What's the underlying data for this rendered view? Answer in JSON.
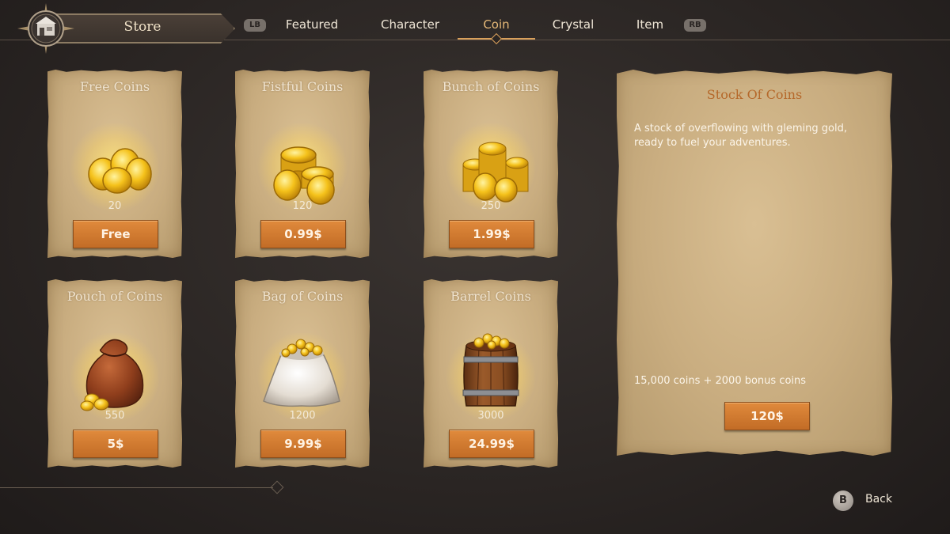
{
  "header": {
    "title": "Store",
    "lb_hint": "LB",
    "rb_hint": "RB",
    "tabs": [
      {
        "label": "Featured"
      },
      {
        "label": "Character"
      },
      {
        "label": "Coin"
      },
      {
        "label": "Crystal"
      },
      {
        "label": "Item"
      }
    ],
    "active_tab": "Coin"
  },
  "products": [
    {
      "title": "Free Coins",
      "amount": "20",
      "price": "Free",
      "icon": "coin-pile-icon"
    },
    {
      "title": "Fistful Coins",
      "amount": "120",
      "price": "0.99$",
      "icon": "coin-stacks-icon"
    },
    {
      "title": "Bunch of Coins",
      "amount": "250",
      "price": "1.99$",
      "icon": "coin-heap-icon"
    },
    {
      "title": "Pouch of Coins",
      "amount": "550",
      "price": "5$",
      "icon": "coin-pouch-icon"
    },
    {
      "title": "Bag of Coins",
      "amount": "1200",
      "price": "9.99$",
      "icon": "coin-sack-icon"
    },
    {
      "title": "Barrel Coins",
      "amount": "3000",
      "price": "24.99$",
      "icon": "coin-barrel-icon"
    }
  ],
  "detail": {
    "title": "Stock Of Coins",
    "description": "A stock of overflowing with gleming gold, ready to fuel your adventures.",
    "bonus": "15,000 coins + 2000 bonus coins",
    "price": "120$"
  },
  "footer": {
    "back_key": "B",
    "back_label": "Back"
  },
  "colors": {
    "accent": "#d9a05b",
    "button": "#d37a31",
    "background": "#2a2523",
    "parchment": "#c9ad80"
  }
}
